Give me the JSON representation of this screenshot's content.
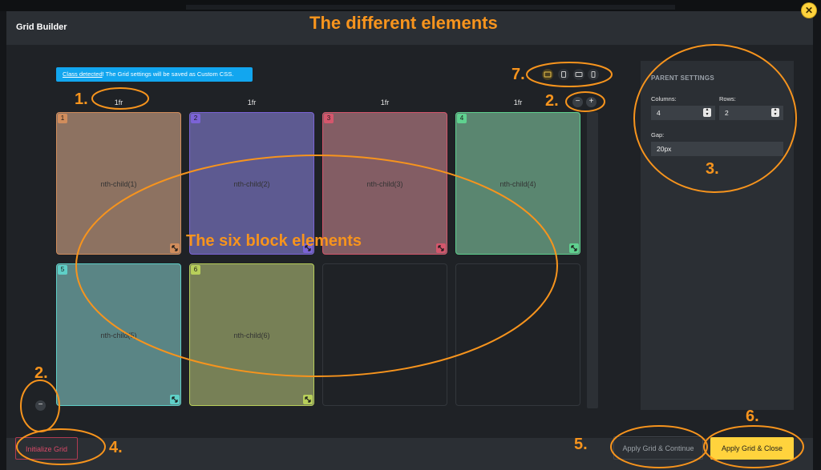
{
  "app": {
    "title": "Grid Builder",
    "close_icon": "close-icon"
  },
  "notice": {
    "link": "Class detected",
    "text": "! The Grid settings will be saved as Custom CSS."
  },
  "columns": [
    "1fr",
    "1fr",
    "1fr",
    "1fr"
  ],
  "col_controls": {
    "remove": "−",
    "add": "+"
  },
  "row_controls": {
    "remove": "−"
  },
  "devices": [
    {
      "icon": "desktop-icon"
    },
    {
      "icon": "tablet-portrait-icon"
    },
    {
      "icon": "tablet-landscape-icon"
    },
    {
      "icon": "mobile-icon"
    }
  ],
  "cells": [
    {
      "num": "1",
      "label": "nth-child(1)",
      "bg": "#8d7261",
      "border": "#d18d5c",
      "badge": "#d18d5c"
    },
    {
      "num": "2",
      "label": "nth-child(2)",
      "bg": "#5d5a91",
      "border": "#7b63d6",
      "badge": "#7b63d6"
    },
    {
      "num": "3",
      "label": "nth-child(3)",
      "bg": "#835d64",
      "border": "#d4566c",
      "badge": "#d4566c"
    },
    {
      "num": "4",
      "label": "nth-child(4)",
      "bg": "#5a8670",
      "border": "#5fd18f",
      "badge": "#5fd18f"
    },
    {
      "num": "5",
      "label": "nth-child(5)",
      "bg": "#5a8585",
      "border": "#5fcfc7",
      "badge": "#5fcfc7"
    },
    {
      "num": "6",
      "label": "nth-child(6)",
      "bg": "#778056",
      "border": "#b7cf5a",
      "badge": "#b7cf5a"
    }
  ],
  "settings": {
    "heading": "PARENT SETTINGS",
    "columns_label": "Columns:",
    "columns_value": "4",
    "rows_label": "Rows:",
    "rows_value": "2",
    "gap_label": "Gap:",
    "gap_value": "20px"
  },
  "footer": {
    "initialize": "Initialize Grid",
    "apply_continue": "Apply Grid & Continue",
    "apply_close": "Apply Grid & Close"
  },
  "annotations": {
    "title": "The different elements",
    "blocks": "The six block elements",
    "n1": "1.",
    "n2a": "2.",
    "n2b": "2.",
    "n3": "3.",
    "n4": "4.",
    "n5": "5.",
    "n6": "6.",
    "n7": "7.",
    "color": "#f7941d"
  }
}
